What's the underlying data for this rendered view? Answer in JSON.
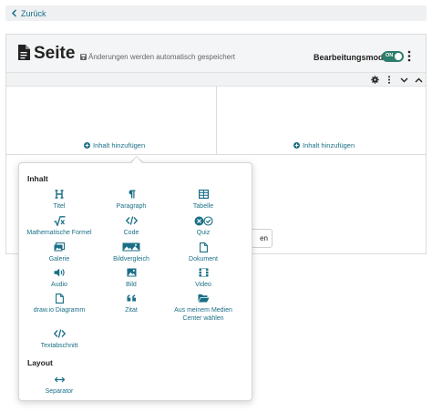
{
  "back": {
    "label": "Zurück"
  },
  "header": {
    "title": "Seite",
    "autosave_note": "Änderungen werden automatisch gespeichert",
    "edit_mode_label": "Bearbeitungsmodus",
    "toggle_text": "ON",
    "toggle_state": "on"
  },
  "editor": {
    "add_content_left": "Inhalt hinzufügen",
    "add_content_right": "Inhalt hinzufügen",
    "partial_button_text": "en"
  },
  "menu": {
    "section_content": "Inhalt",
    "section_layout": "Layout",
    "content_items": [
      {
        "label": "Titel",
        "icon": "heading-icon"
      },
      {
        "label": "Paragraph",
        "icon": "paragraph-icon"
      },
      {
        "label": "Tabelle",
        "icon": "table-icon"
      },
      {
        "label": "Mathematische Formel",
        "icon": "formula-icon"
      },
      {
        "label": "Code",
        "icon": "code-icon"
      },
      {
        "label": "Quiz",
        "icon": "quiz-icon"
      },
      {
        "label": "Galerie",
        "icon": "gallery-icon"
      },
      {
        "label": "Bildvergleich",
        "icon": "image-compare-icon"
      },
      {
        "label": "Dokument",
        "icon": "document-icon"
      },
      {
        "label": "Audio",
        "icon": "audio-icon"
      },
      {
        "label": "Bild",
        "icon": "image-icon"
      },
      {
        "label": "Video",
        "icon": "video-icon"
      },
      {
        "label": "draw.io Diagramm",
        "icon": "diagram-icon"
      },
      {
        "label": "Zitat",
        "icon": "quote-icon"
      },
      {
        "label": "Aus meinem Medien Center wählen",
        "icon": "folder-icon"
      },
      {
        "label": "Textabschnitt",
        "icon": "text-section-icon"
      }
    ],
    "layout_items": [
      {
        "label": "Separator",
        "icon": "separator-icon"
      }
    ]
  },
  "colors": {
    "accent": "#1a6f87",
    "toggle_on": "#2f7d6b",
    "header_bg": "#f4f5f6"
  }
}
